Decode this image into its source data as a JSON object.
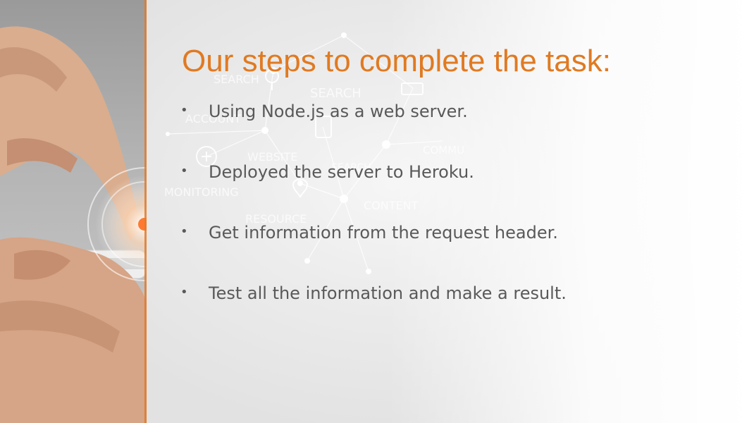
{
  "slide": {
    "title": "Our steps to complete the task:",
    "bullets": [
      "Using Node.js as a web server.",
      "Deployed the server to Heroku.",
      "Get information from the request header.",
      "Test all the information and make a result."
    ],
    "bullet_glyph": "•",
    "accent_color": "#e07a22",
    "text_color": "#595959"
  },
  "background": {
    "network_words": [
      "SEARCH",
      "SEARCH",
      "ACCOUNT",
      "WEBSITE",
      "SEARCH",
      "COMMU",
      "MONITORING",
      "CONTENT",
      "RESOURCE"
    ]
  },
  "photo": {
    "icon": "hand-holding-phone-photo"
  }
}
